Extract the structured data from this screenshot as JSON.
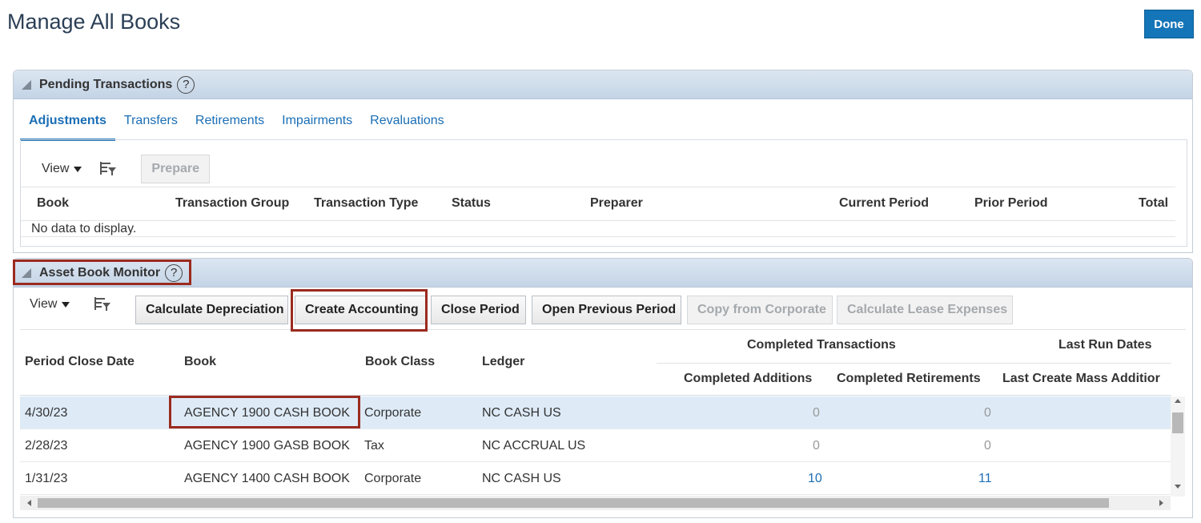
{
  "page": {
    "title": "Manage All Books",
    "done_label": "Done"
  },
  "pending": {
    "title": "Pending Transactions",
    "help": "?",
    "tabs": [
      {
        "label": "Adjustments",
        "active": true
      },
      {
        "label": "Transfers"
      },
      {
        "label": "Retirements"
      },
      {
        "label": "Impairments"
      },
      {
        "label": "Revaluations"
      }
    ],
    "view_label": "View",
    "prepare_label": "Prepare",
    "columns": [
      "Book",
      "Transaction Group",
      "Transaction Type",
      "Status",
      "Preparer",
      "Current Period",
      "Prior Period",
      "Total"
    ],
    "empty_text": "No data to display."
  },
  "monitor": {
    "title": "Asset Book Monitor",
    "help": "?",
    "view_label": "View",
    "buttons": {
      "calc_dep": "Calculate Depreciation",
      "create_acct": "Create Accounting",
      "close_period": "Close Period",
      "open_prev": "Open Previous Period",
      "copy_corp": "Copy from Corporate",
      "calc_lease": "Calculate Lease Expenses"
    },
    "headers": {
      "period_close": "Period Close Date",
      "book": "Book",
      "book_class": "Book Class",
      "ledger": "Ledger",
      "completed_group": "Completed Transactions",
      "last_run_group": "Last Run Dates",
      "completed_additions": "Completed Additions",
      "completed_retirements": "Completed Retirements",
      "last_create_mass": "Last Create Mass Additior"
    },
    "rows": [
      {
        "date": "4/30/23",
        "book": "AGENCY 1900 CASH BOOK",
        "class": "Corporate",
        "ledger": "NC CASH US",
        "additions": "0",
        "retirements": "0"
      },
      {
        "date": "2/28/23",
        "book": "AGENCY 1900 GASB BOOK",
        "class": "Tax",
        "ledger": "NC ACCRUAL US",
        "additions": "0",
        "retirements": "0"
      },
      {
        "date": "1/31/23",
        "book": "AGENCY 1400 CASH BOOK",
        "class": "Corporate",
        "ledger": "NC CASH US",
        "additions": "10",
        "retirements": "11"
      }
    ]
  },
  "colors": {
    "accent": "#1475b8",
    "highlight": "#9b2a1f",
    "link": "#1b6eb5",
    "selected_row": "#deebf7"
  }
}
